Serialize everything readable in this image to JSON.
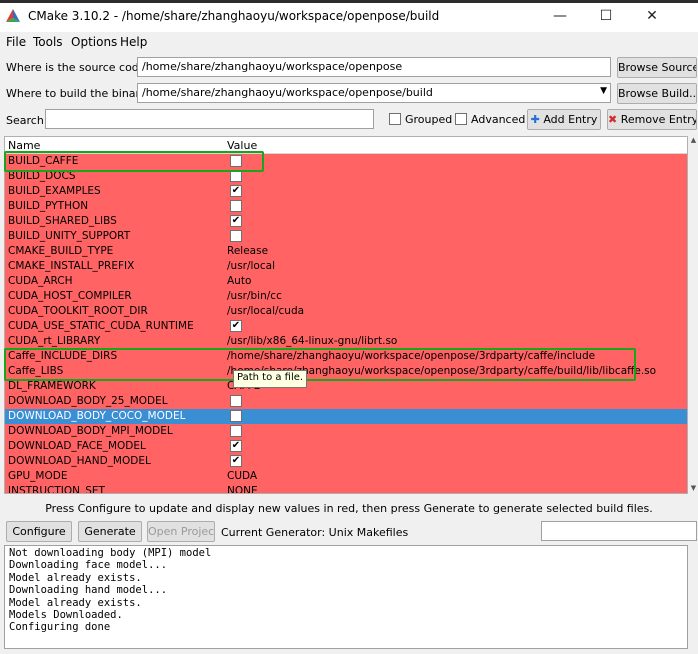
{
  "window": {
    "title": "CMake 3.10.2 - /home/share/zhanghaoyu/workspace/openpose/build",
    "controls": {
      "minimize": "—",
      "maximize": "☐",
      "close": "✕"
    }
  },
  "menu": [
    "File",
    "Tools",
    "Options",
    "Help"
  ],
  "source": {
    "label": "Where is the source code:",
    "value": "/home/share/zhanghaoyu/workspace/openpose",
    "button": "Browse Source..."
  },
  "build": {
    "label": "Where to build the binaries:",
    "value": "/home/share/zhanghaoyu/workspace/openpose/build",
    "button": "Browse Build..."
  },
  "search": {
    "label": "Search:",
    "value": "",
    "grouped": "Grouped",
    "advanced": "Advanced",
    "add_entry": "Add Entry",
    "remove_entry": "Remove Entry"
  },
  "table": {
    "headers": [
      "Name",
      "Value"
    ],
    "rows": [
      {
        "name": "BUILD_CAFFE",
        "type": "bool",
        "value": false
      },
      {
        "name": "BUILD_DOCS",
        "type": "bool",
        "value": false
      },
      {
        "name": "BUILD_EXAMPLES",
        "type": "bool",
        "value": true
      },
      {
        "name": "BUILD_PYTHON",
        "type": "bool",
        "value": false
      },
      {
        "name": "BUILD_SHARED_LIBS",
        "type": "bool",
        "value": true
      },
      {
        "name": "BUILD_UNITY_SUPPORT",
        "type": "bool",
        "value": false
      },
      {
        "name": "CMAKE_BUILD_TYPE",
        "type": "text",
        "value": "Release"
      },
      {
        "name": "CMAKE_INSTALL_PREFIX",
        "type": "text",
        "value": "/usr/local"
      },
      {
        "name": "CUDA_ARCH",
        "type": "text",
        "value": "Auto"
      },
      {
        "name": "CUDA_HOST_COMPILER",
        "type": "text",
        "value": "/usr/bin/cc"
      },
      {
        "name": "CUDA_TOOLKIT_ROOT_DIR",
        "type": "text",
        "value": "/usr/local/cuda"
      },
      {
        "name": "CUDA_USE_STATIC_CUDA_RUNTIME",
        "type": "bool",
        "value": true
      },
      {
        "name": "CUDA_rt_LIBRARY",
        "type": "text",
        "value": "/usr/lib/x86_64-linux-gnu/librt.so"
      },
      {
        "name": "Caffe_INCLUDE_DIRS",
        "type": "text",
        "value": "/home/share/zhanghaoyu/workspace/openpose/3rdparty/caffe/include"
      },
      {
        "name": "Caffe_LIBS",
        "type": "text",
        "value": "/home/share/zhanghaoyu/workspace/openpose/3rdparty/caffe/build/lib/libcaffe.so"
      },
      {
        "name": "DL_FRAMEWORK",
        "type": "text",
        "value": "CAFFE"
      },
      {
        "name": "DOWNLOAD_BODY_25_MODEL",
        "type": "bool",
        "value": false
      },
      {
        "name": "DOWNLOAD_BODY_COCO_MODEL",
        "type": "bool",
        "value": false,
        "selected": true
      },
      {
        "name": "DOWNLOAD_BODY_MPI_MODEL",
        "type": "bool",
        "value": false
      },
      {
        "name": "DOWNLOAD_FACE_MODEL",
        "type": "bool",
        "value": true
      },
      {
        "name": "DOWNLOAD_HAND_MODEL",
        "type": "bool",
        "value": true
      },
      {
        "name": "GPU_MODE",
        "type": "text",
        "value": "CUDA"
      },
      {
        "name": "INSTRUCTION_SET",
        "type": "text",
        "value": "NONE"
      }
    ]
  },
  "tooltip": "Path to a file.",
  "status": "Press Configure to update and display new values in red, then press Generate to generate selected build files.",
  "actions": {
    "configure": "Configure",
    "generate": "Generate",
    "open_project": "Open Project",
    "generator": "Current Generator: Unix Makefiles"
  },
  "log": [
    "Not downloading body (MPI) model",
    "Downloading face model...",
    "Model already exists.",
    "Downloading hand model...",
    "Model already exists.",
    "Models Downloaded.",
    "Configuring done"
  ],
  "colors": {
    "changed_row": "#ff6363",
    "selected_row": "#3a8ed4",
    "highlight_box": "#1aa51a"
  }
}
